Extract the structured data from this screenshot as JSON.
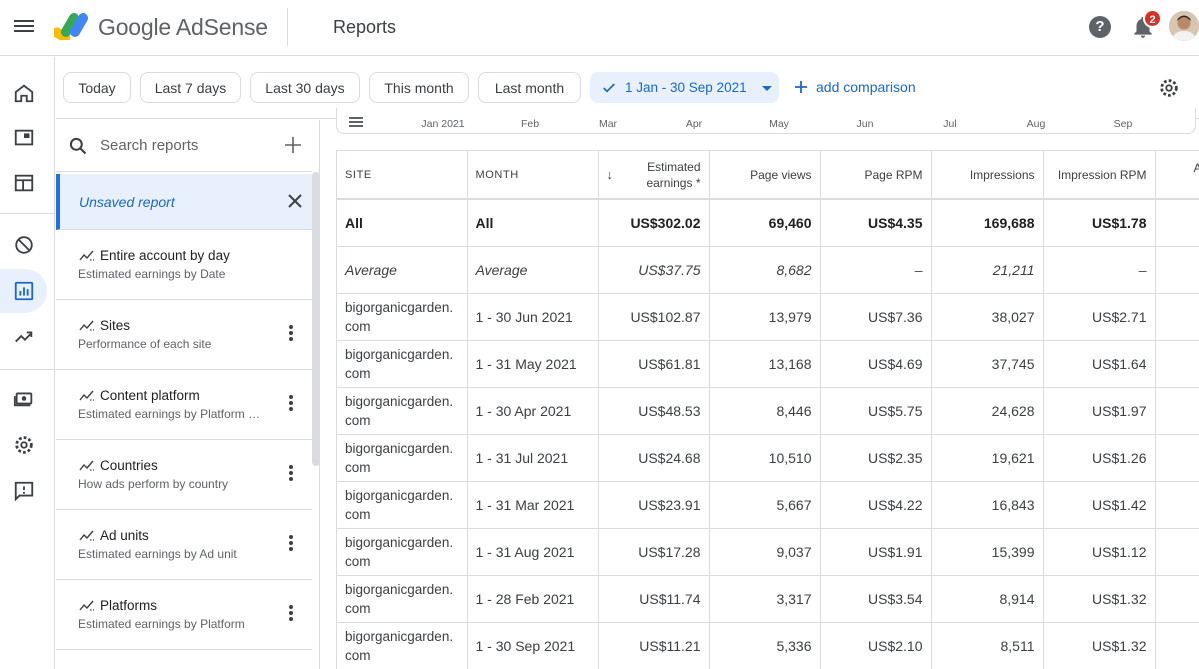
{
  "app": {
    "brand": "Google AdSense",
    "page_title": "Reports",
    "notification_count": "2"
  },
  "rail": {
    "items": [
      {
        "name": "home-icon"
      },
      {
        "name": "ads-icon"
      },
      {
        "name": "sites-icon"
      },
      {
        "name": "block-icon"
      },
      {
        "name": "reports-icon",
        "active": true
      },
      {
        "name": "optimization-icon"
      },
      {
        "name": "payments-icon"
      },
      {
        "name": "settings-icon"
      },
      {
        "name": "feedback-icon"
      }
    ]
  },
  "filters": {
    "chips": [
      "Today",
      "Last 7 days",
      "Last 30 days",
      "This month",
      "Last month"
    ],
    "selected_range": "1 Jan - 30 Sep 2021",
    "add_comparison": "add comparison"
  },
  "side": {
    "search_placeholder": "Search reports",
    "unsaved_label": "Unsaved report",
    "reports": [
      {
        "title": "Entire account by day",
        "subtitle": "Estimated earnings by Date",
        "menu": false
      },
      {
        "title": "Sites",
        "subtitle": "Performance of each site",
        "menu": true
      },
      {
        "title": "Content platform",
        "subtitle": "Estimated earnings by Platform type",
        "menu": true
      },
      {
        "title": "Countries",
        "subtitle": "How ads perform by country",
        "menu": true
      },
      {
        "title": "Ad units",
        "subtitle": "Estimated earnings by Ad unit",
        "menu": true
      },
      {
        "title": "Platforms",
        "subtitle": "Estimated earnings by Platform",
        "menu": true
      }
    ]
  },
  "chart_strip": {
    "months": [
      "Jan 2021",
      "Feb",
      "Mar",
      "Apr",
      "May",
      "Jun",
      "Jul",
      "Aug",
      "Sep"
    ]
  },
  "table": {
    "columns": [
      "SITE",
      "MONTH",
      "Estimated earnings *",
      "Page views",
      "Page RPM",
      "Impressions",
      "Impression RPM",
      "A"
    ],
    "total": [
      "All",
      "All",
      "US$302.02",
      "69,460",
      "US$4.35",
      "169,688",
      "US$1.78",
      ""
    ],
    "average": [
      "Average",
      "Average",
      "US$37.75",
      "8,682",
      "–",
      "21,211",
      "–",
      ""
    ],
    "rows": [
      [
        "bigorganicgarden.\ncom",
        "1 - 30 Jun 2021",
        "US$102.87",
        "13,979",
        "US$7.36",
        "38,027",
        "US$2.71",
        ""
      ],
      [
        "bigorganicgarden.\ncom",
        "1 - 31 May 2021",
        "US$61.81",
        "13,168",
        "US$4.69",
        "37,745",
        "US$1.64",
        ""
      ],
      [
        "bigorganicgarden.\ncom",
        "1 - 30 Apr 2021",
        "US$48.53",
        "8,446",
        "US$5.75",
        "24,628",
        "US$1.97",
        ""
      ],
      [
        "bigorganicgarden.\ncom",
        "1 - 31 Jul 2021",
        "US$24.68",
        "10,510",
        "US$2.35",
        "19,621",
        "US$1.26",
        ""
      ],
      [
        "bigorganicgarden.\ncom",
        "1 - 31 Mar 2021",
        "US$23.91",
        "5,667",
        "US$4.22",
        "16,843",
        "US$1.42",
        ""
      ],
      [
        "bigorganicgarden.\ncom",
        "1 - 31 Aug 2021",
        "US$17.28",
        "9,037",
        "US$1.91",
        "15,399",
        "US$1.12",
        ""
      ],
      [
        "bigorganicgarden.\ncom",
        "1 - 28 Feb 2021",
        "US$11.74",
        "3,317",
        "US$3.54",
        "8,914",
        "US$1.32",
        ""
      ],
      [
        "bigorganicgarden.\ncom",
        "1 - 30 Sep 2021",
        "US$11.21",
        "5,336",
        "US$2.10",
        "8,511",
        "US$1.32",
        ""
      ]
    ]
  }
}
